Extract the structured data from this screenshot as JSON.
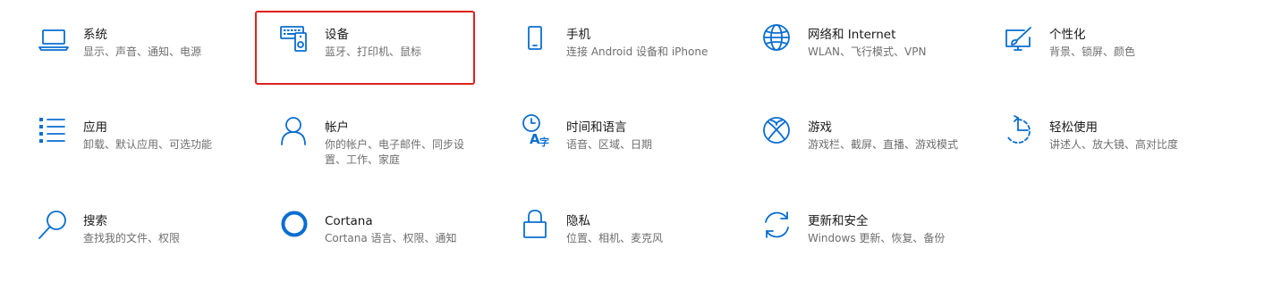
{
  "settings_tiles": [
    {
      "id": "system",
      "title": "系统",
      "desc": "显示、声音、通知、电源",
      "icon": "laptop-icon"
    },
    {
      "id": "devices",
      "title": "设备",
      "desc": "蓝牙、打印机、鼠标",
      "icon": "devices-icon"
    },
    {
      "id": "phone",
      "title": "手机",
      "desc": "连接 Android 设备和 iPhone",
      "icon": "phone-icon"
    },
    {
      "id": "network",
      "title": "网络和 Internet",
      "desc": "WLAN、飞行模式、VPN",
      "icon": "globe-icon"
    },
    {
      "id": "personalization",
      "title": "个性化",
      "desc": "背景、锁屏、颜色",
      "icon": "personalization-icon"
    },
    {
      "id": "apps",
      "title": "应用",
      "desc": "卸载、默认应用、可选功能",
      "icon": "apps-list-icon"
    },
    {
      "id": "accounts",
      "title": "帐户",
      "desc": "你的帐户、电子邮件、同步设置、工作、家庭",
      "icon": "person-icon"
    },
    {
      "id": "time_language",
      "title": "时间和语言",
      "desc": "语音、区域、日期",
      "icon": "time-language-icon"
    },
    {
      "id": "gaming",
      "title": "游戏",
      "desc": "游戏栏、截屏、直播、游戏模式",
      "icon": "xbox-icon"
    },
    {
      "id": "ease_of_access",
      "title": "轻松使用",
      "desc": "讲述人、放大镜、高对比度",
      "icon": "ease-of-access-icon"
    },
    {
      "id": "search",
      "title": "搜索",
      "desc": "查找我的文件、权限",
      "icon": "search-icon"
    },
    {
      "id": "cortana",
      "title": "Cortana",
      "desc": "Cortana 语言、权限、通知",
      "icon": "cortana-icon"
    },
    {
      "id": "privacy",
      "title": "隐私",
      "desc": "位置、相机、麦克风",
      "icon": "lock-icon"
    },
    {
      "id": "update_security",
      "title": "更新和安全",
      "desc": "Windows 更新、恢复、备份",
      "icon": "sync-icon"
    }
  ],
  "highlight": {
    "target": "devices",
    "color": "#e02020"
  },
  "colors": {
    "accent": "#0a6ed1",
    "title": "#1a1a1a",
    "desc": "#6e6e6e"
  }
}
